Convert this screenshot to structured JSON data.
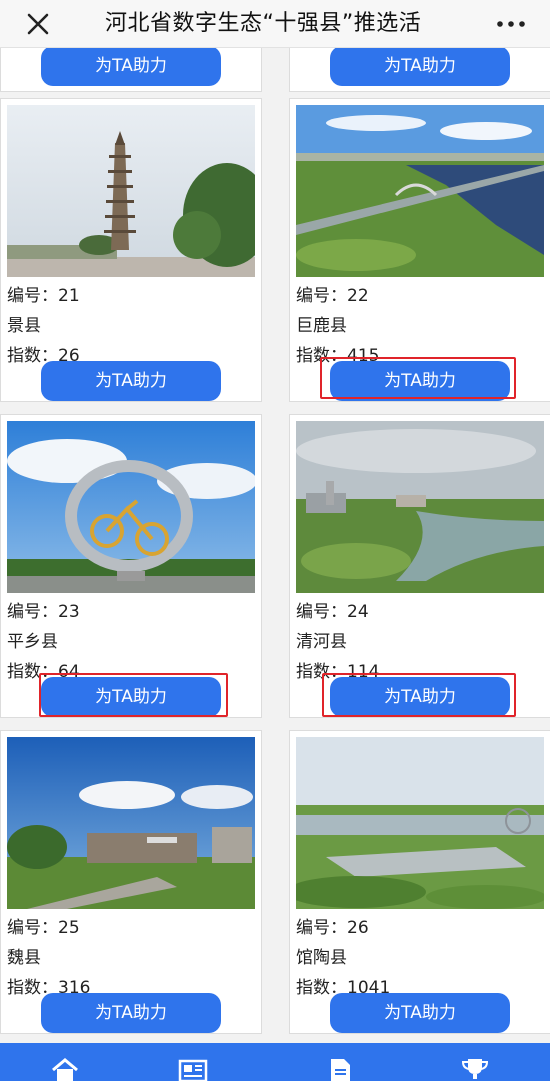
{
  "titlebar": {
    "title": "河北省数字生态“十强县”推选活",
    "close_icon": "close-icon",
    "more_icon": "more-icon"
  },
  "vote_label": "为TA助力",
  "cards": [
    {
      "number": "编号：21",
      "county": "景县",
      "index": "指数：26",
      "image": "pagoda-photo"
    },
    {
      "number": "编号：22",
      "county": "巨鹿县",
      "index": "指数：415",
      "image": "river-bridge-aerial-photo"
    },
    {
      "number": "编号：23",
      "county": "平乡县",
      "index": "指数：64",
      "image": "bicycle-sculpture-photo"
    },
    {
      "number": "编号：24",
      "county": "清河县",
      "index": "指数：114",
      "image": "river-park-aerial-photo"
    },
    {
      "number": "编号：25",
      "county": "魏县",
      "index": "指数：316",
      "image": "museum-building-photo"
    },
    {
      "number": "编号：26",
      "county": "馆陶县",
      "index": "指数：1041",
      "image": "ferris-wheel-park-photo"
    }
  ],
  "bottom_nav": [
    "home-icon",
    "news-icon",
    "document-icon",
    "trophy-icon"
  ],
  "colors": {
    "accent": "#2f74ec",
    "highlight": "#e0242a"
  }
}
